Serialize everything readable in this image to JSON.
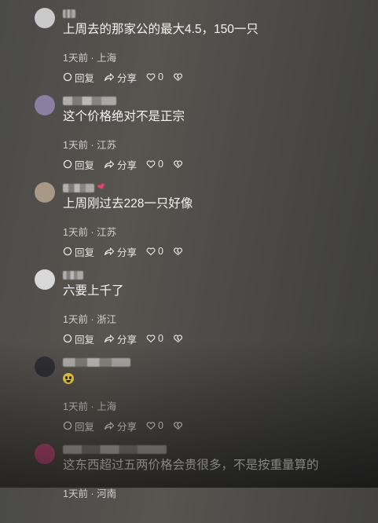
{
  "actions": {
    "reply": "回复",
    "share": "分享",
    "like_count": "0"
  },
  "comments": [
    {
      "text": "上周去的那家公的最大4.5，150一只",
      "time": "1天前",
      "location": "上海",
      "avatar_color": "#c9c9c9"
    },
    {
      "text": "这个价格绝对不是正宗",
      "time": "1天前",
      "location": "江苏",
      "avatar_color": "#8a7fa0"
    },
    {
      "text": "上周刚过去228一只好像",
      "time": "1天前",
      "location": "江苏",
      "avatar_color": "#a89886"
    },
    {
      "text": "六要上千了",
      "time": "1天前",
      "location": "浙江",
      "avatar_color": "#d8d8d8"
    },
    {
      "text": "",
      "emoji": "smiley-emoji",
      "time": "1天前",
      "location": "上海",
      "avatar_color": "#2f2f35"
    },
    {
      "text": "这东西超过五两价格会贵很多，不是按重量算的",
      "time": "1天前",
      "location": "河南",
      "avatar_color": "#c0507a"
    }
  ]
}
